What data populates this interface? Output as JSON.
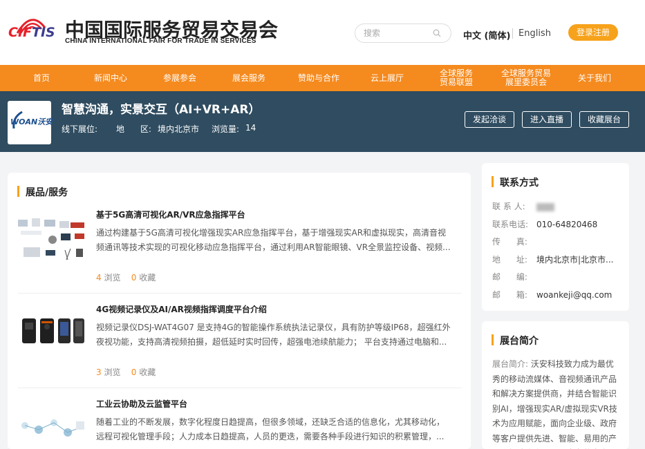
{
  "header": {
    "logo_text": "CIFTIS",
    "brand_cn": "中国国际服务贸易交易会",
    "brand_en": "CHINA INTERNATIONAL FAIR FOR TRADE IN SERVICES",
    "search_placeholder": "搜索",
    "lang_cn": "中文 (简体)",
    "lang_en": "English",
    "register_label": "登录注册"
  },
  "nav": {
    "items": [
      "首页",
      "新闻中心",
      "参展参会",
      "展会服务",
      "赞助与合作",
      "云上展厅",
      "全球服务\n贸易联盟",
      "全球服务贸易\n展里委员会",
      "关于我们"
    ]
  },
  "exhibitor": {
    "logo_text": "WOAN沃安",
    "title": "智慧沟通，实景交互（AI+VR+AR）",
    "booth_label": "线下展位:",
    "region_label": "地      区:",
    "region_value": "境内北京市",
    "views_label": "浏览量:",
    "views_value": "14",
    "btn_negotiate": "发起洽谈",
    "btn_live": "进入直播",
    "btn_favorite": "收藏展台"
  },
  "products": {
    "section_title": "展品/服务",
    "items": [
      {
        "name": "基于5G高清可视化AR/VR应急指挥平台",
        "desc": "通过构建基于5G高清可视化增强现实AR应急指挥平台，基于增强现实AR和虚拟现实，高清音视频通讯等技术实现的可视化移动应急指挥平台，通过利用AR智能眼镜、VR全景监控设备、视频...",
        "views": "4",
        "views_label": "浏览",
        "favs": "0",
        "favs_label": "收藏"
      },
      {
        "name": "4G视频记录仪及AI/AR视频指挥调度平台介绍",
        "desc": "视频记录仪DSJ-WAT4G07 是支持4G的智能操作系统执法记录仪，具有防护等级IP68，超强红外夜视功能，支持高清视频拍摄，超低延时实时回传，超强电池续航能力； 平台支持通过电脑和...",
        "views": "3",
        "views_label": "浏览",
        "favs": "0",
        "favs_label": "收藏"
      },
      {
        "name": "工业云协助及云监管平台",
        "desc": "随着工业的不断发展，数字化程度日趋提高，但很多领域，还缺乏合适的信息化，尤其移动化，远程可视化管理手段；人力成本日趋提高，人员的更迭，需要各种手段进行知识的积累管理，...",
        "views": "",
        "views_label": "",
        "favs": "",
        "favs_label": ""
      }
    ]
  },
  "contact": {
    "title": "联系方式",
    "rows": [
      {
        "k": "联 系 人:",
        "v": ""
      },
      {
        "k": "联系电话:",
        "v": "010-64820468"
      },
      {
        "k": "传      真:",
        "v": ""
      },
      {
        "k": "地      址:",
        "v": "境内北京市|北京市..."
      },
      {
        "k": "邮      编:",
        "v": ""
      },
      {
        "k": "邮      箱:",
        "v": "woankeji@qq.com"
      }
    ]
  },
  "intro": {
    "title": "展台简介",
    "label": "展台简介:",
    "text": "沃安科技致力成为最优秀的移动流媒体、音视频通讯产品和解决方案提供商，并结合智能识别AI，增强现实AR/虚拟现实VR技术为应用赋能，面向企业级、政府等客户提供先进、智能、易用的产品和解决方案，以及完备的客户"
  },
  "colors": {
    "accent": "#f58a1e",
    "hero_bg": "#2f4c60",
    "button_orange": "#f7a21b"
  }
}
